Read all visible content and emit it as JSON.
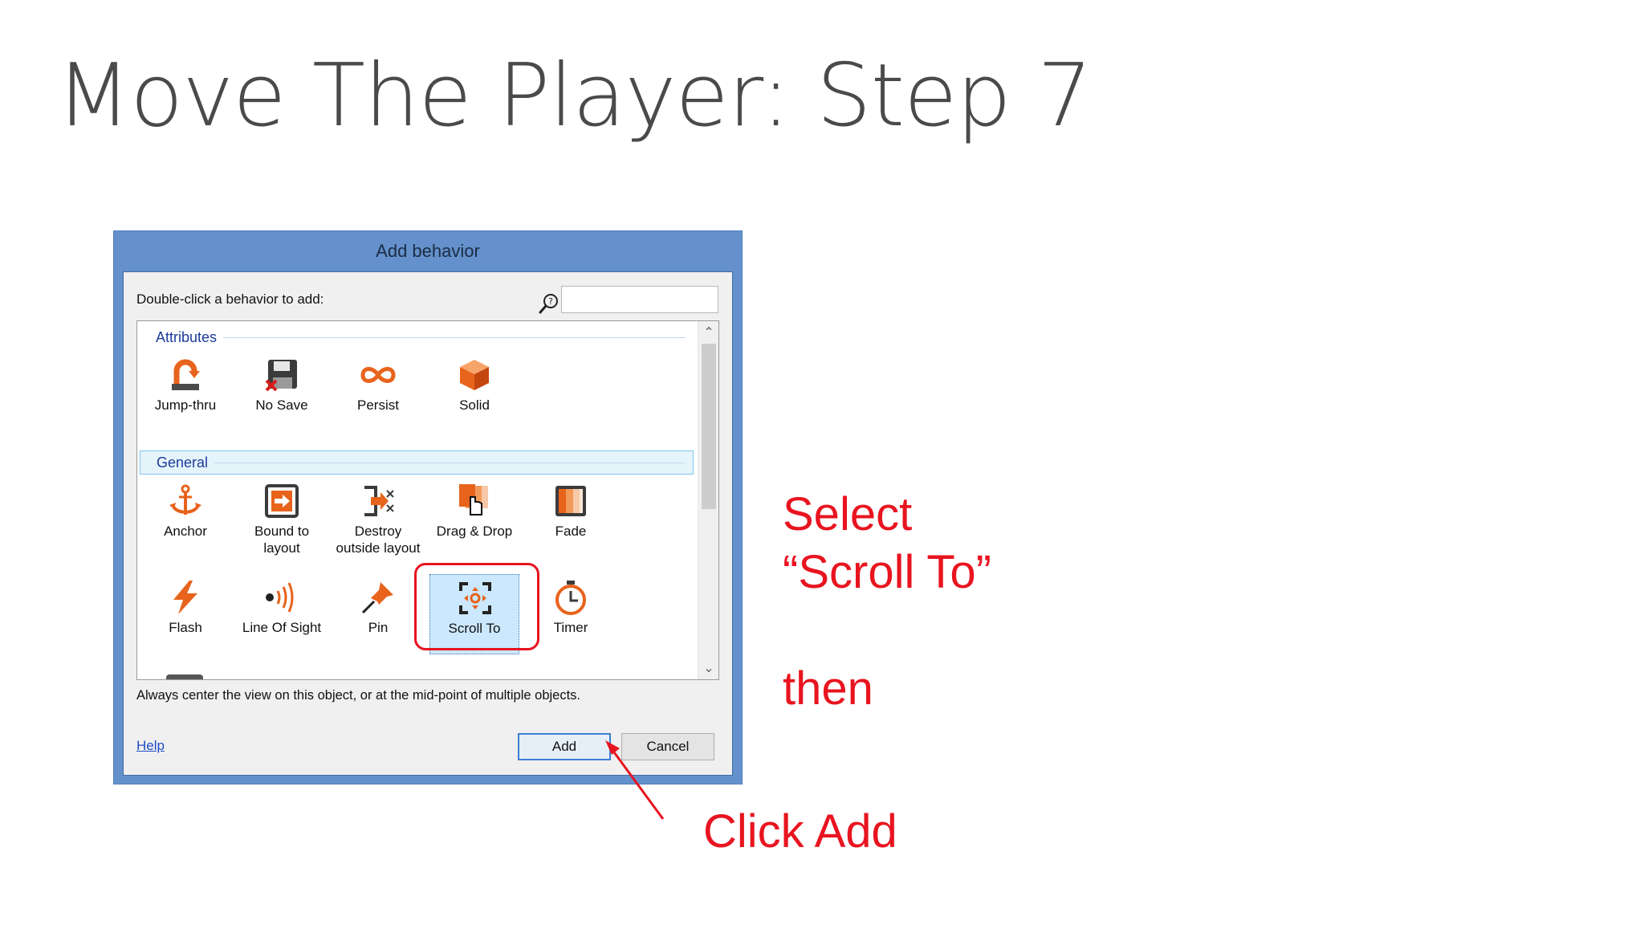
{
  "slide": {
    "title": "Move The Player: Step 7",
    "annotations": {
      "select_line1": "Select",
      "select_line2": "“Scroll To”",
      "then": "then",
      "click_add": "Click Add"
    }
  },
  "dialog": {
    "title": "Add behavior",
    "prompt": "Double-click a behavior to add:",
    "search": {
      "value": "",
      "placeholder": ""
    },
    "categories": [
      {
        "label": "Attributes",
        "items": [
          {
            "label": "Jump-thru",
            "icon": "jump-thru-icon"
          },
          {
            "label": "No Save",
            "icon": "no-save-icon"
          },
          {
            "label": "Persist",
            "icon": "persist-icon"
          },
          {
            "label": "Solid",
            "icon": "solid-icon"
          }
        ]
      },
      {
        "label": "General",
        "items": [
          {
            "label": "Anchor",
            "icon": "anchor-icon"
          },
          {
            "label": "Bound to\nlayout",
            "icon": "bound-to-layout-icon"
          },
          {
            "label": "Destroy\noutside layout",
            "icon": "destroy-outside-layout-icon"
          },
          {
            "label": "Drag & Drop",
            "icon": "drag-drop-icon"
          },
          {
            "label": "Fade",
            "icon": "fade-icon"
          },
          {
            "label": "Flash",
            "icon": "flash-icon"
          },
          {
            "label": "Line Of Sight",
            "icon": "line-of-sight-icon"
          },
          {
            "label": "Pin",
            "icon": "pin-icon"
          },
          {
            "label": "Scroll To",
            "icon": "scroll-to-icon",
            "selected": true
          },
          {
            "label": "Timer",
            "icon": "timer-icon"
          }
        ]
      }
    ],
    "description": "Always center the view on this object, or at the mid-point of multiple objects.",
    "help_label": "Help",
    "add_label": "Add",
    "cancel_label": "Cancel"
  },
  "colors": {
    "annotation_red": "#e8141f",
    "dialog_frame": "#6491cb",
    "selection_fill": "#cce8ff",
    "icon_orange": "#e8631c"
  }
}
